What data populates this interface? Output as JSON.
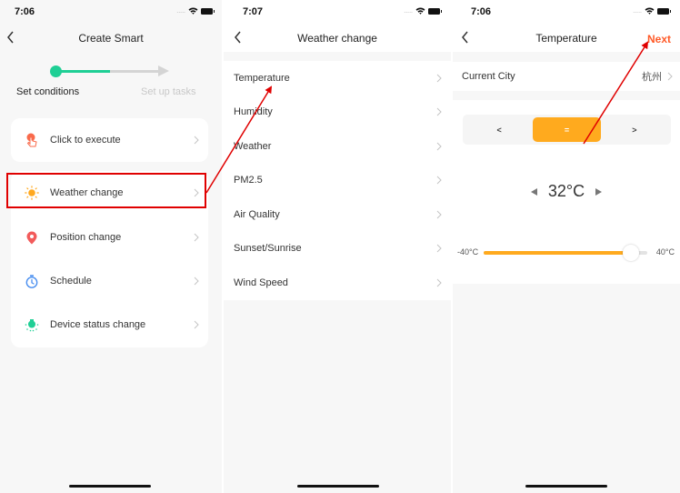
{
  "screens": [
    {
      "status": {
        "time": "7:06",
        "signal_dots": "....."
      },
      "nav": {
        "title": "Create Smart"
      },
      "stepper": {
        "steps": [
          {
            "label": "Set conditions",
            "state": "active"
          },
          {
            "label": "Set up tasks",
            "state": "inactive"
          }
        ],
        "progress": 0.5
      },
      "conditions": [
        {
          "label": "Click to execute",
          "icon": "tap-hand-icon",
          "color": "#f96a4b"
        },
        {
          "label": "Weather change",
          "icon": "sun-icon",
          "color": "#ffa81e",
          "highlighted": true
        },
        {
          "label": "Position change",
          "icon": "location-pin-icon",
          "color": "#f25b5b"
        },
        {
          "label": "Schedule",
          "icon": "stopwatch-icon",
          "color": "#4a8ff0"
        },
        {
          "label": "Device status change",
          "icon": "bulb-icon",
          "color": "#1fcf95"
        }
      ]
    },
    {
      "status": {
        "time": "7:07",
        "signal_dots": "....."
      },
      "nav": {
        "title": "Weather change"
      },
      "options": [
        "Temperature",
        "Humidity",
        "Weather",
        "PM2.5",
        "Air Quality",
        "Sunset/Sunrise",
        "Wind Speed"
      ]
    },
    {
      "status": {
        "time": "7:06",
        "signal_dots": "....."
      },
      "nav": {
        "title": "Temperature",
        "next_label": "Next"
      },
      "city": {
        "label": "Current City",
        "value": "杭州"
      },
      "comparators": [
        {
          "label": "<",
          "selected": false
        },
        {
          "label": "=",
          "selected": true
        },
        {
          "label": ">",
          "selected": false
        }
      ],
      "temperature": {
        "value_label": "32°C",
        "value": 32
      },
      "slider": {
        "min_label": "-40°C",
        "max_label": "40°C",
        "min": -40,
        "max": 40,
        "value": 32
      }
    }
  ],
  "colors": {
    "accent_green": "#1fcf95",
    "accent_orange": "#ffaa1e",
    "next_red": "#ff5a28",
    "highlight_red": "#e00000"
  }
}
